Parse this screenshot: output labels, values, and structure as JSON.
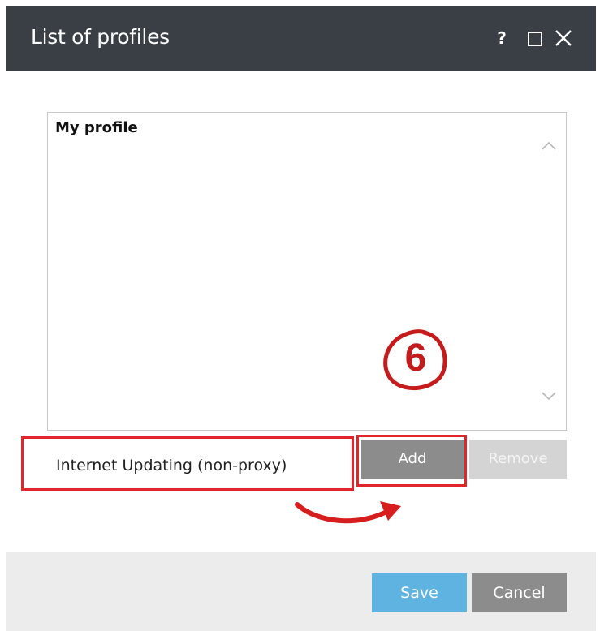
{
  "window": {
    "title": "List of profiles",
    "help_label": "?",
    "colors": {
      "titlebar": "#3a3f45",
      "accent": "#5fb3e0",
      "annotation": "#e0262a"
    }
  },
  "profiles": {
    "items": [
      {
        "label": "My profile"
      }
    ]
  },
  "profile_name_field": {
    "value": "Internet Updating (non-proxy)"
  },
  "buttons": {
    "add": "Add",
    "remove": "Remove",
    "save": "Save",
    "cancel": "Cancel"
  },
  "annotation": {
    "step": "6"
  },
  "icons": [
    "help-icon",
    "maximize-icon",
    "close-icon",
    "scroll-up-icon",
    "scroll-down-icon",
    "arrow-annotation-icon"
  ]
}
